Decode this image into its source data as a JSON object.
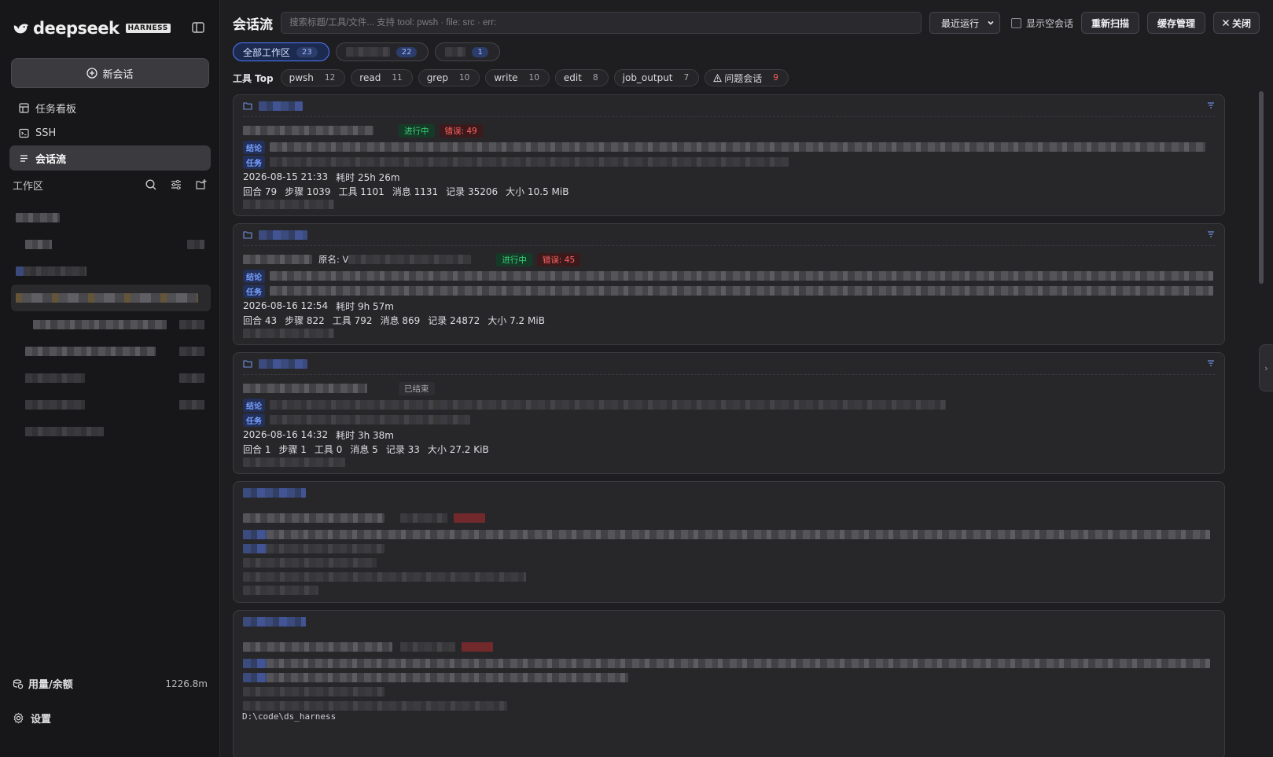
{
  "brand": {
    "name": "deepseek",
    "badge": "HARNESS"
  },
  "sidebar": {
    "new_chat": "新会话",
    "nav": [
      {
        "label": "任务看板",
        "icon": "board-icon"
      },
      {
        "label": "SSH",
        "icon": "terminal-icon"
      },
      {
        "label": "会话流",
        "icon": "list-icon"
      }
    ],
    "workspace_title": "工作区",
    "usage_label": "用量/余额",
    "usage_value": "1226.8m",
    "settings_label": "设置"
  },
  "header": {
    "title": "会话流",
    "search_placeholder": "搜索标题/工具/文件... 支持 tool: pwsh · file: src · err:",
    "sort_value": "最近运行",
    "show_empty_label": "显示空会话",
    "rescan_label": "重新扫描",
    "cache_label": "缓存管理",
    "close_label": "关闭"
  },
  "workspace_filters": [
    {
      "label": "全部工作区",
      "count": "23"
    },
    {
      "label": "",
      "count": "22"
    },
    {
      "label": "",
      "count": "1"
    }
  ],
  "tools": {
    "label": "工具 Top",
    "items": [
      {
        "label": "pwsh",
        "count": "12"
      },
      {
        "label": "read",
        "count": "11"
      },
      {
        "label": "grep",
        "count": "10"
      },
      {
        "label": "write",
        "count": "10"
      },
      {
        "label": "edit",
        "count": "8"
      },
      {
        "label": "job_output",
        "count": "7"
      }
    ],
    "problem": {
      "label": "问题会话",
      "count": "9"
    }
  },
  "sessions": [
    {
      "status": "进行中",
      "errors": "错误: 49",
      "conclusion_tag": "结论",
      "task_tag": "任务",
      "time": "2026-08-15 21:33",
      "duration": "耗时 25h 26m",
      "stats": [
        "回合 79",
        "步骤 1039",
        "工具 1101",
        "消息 1131",
        "记录 35206",
        "大小 10.5 MiB"
      ]
    },
    {
      "status": "进行中",
      "errors": "错误: 45",
      "orig_label": "原名: V",
      "conclusion_tag": "结论",
      "task_tag": "任务",
      "time": "2026-08-16 12:54",
      "duration": "耗时 9h 57m",
      "stats": [
        "回合 43",
        "步骤 822",
        "工具 792",
        "消息 869",
        "记录 24872",
        "大小 7.2 MiB"
      ]
    },
    {
      "status": "已结束",
      "conclusion_tag": "结论",
      "task_tag": "任务",
      "time": "2026-08-16 14:32",
      "duration": "耗时 3h 38m",
      "stats": [
        "回合 1",
        "步骤 1",
        "工具 0",
        "消息 5",
        "记录 33",
        "大小 27.2 KiB"
      ]
    }
  ],
  "footer_path": "D:\\code\\ds_harness",
  "colors": {
    "accent": "#4c7dff",
    "running": "#3ed17a",
    "error": "#ff6464",
    "background": "#1e1e21",
    "sidebar": "#171719"
  }
}
